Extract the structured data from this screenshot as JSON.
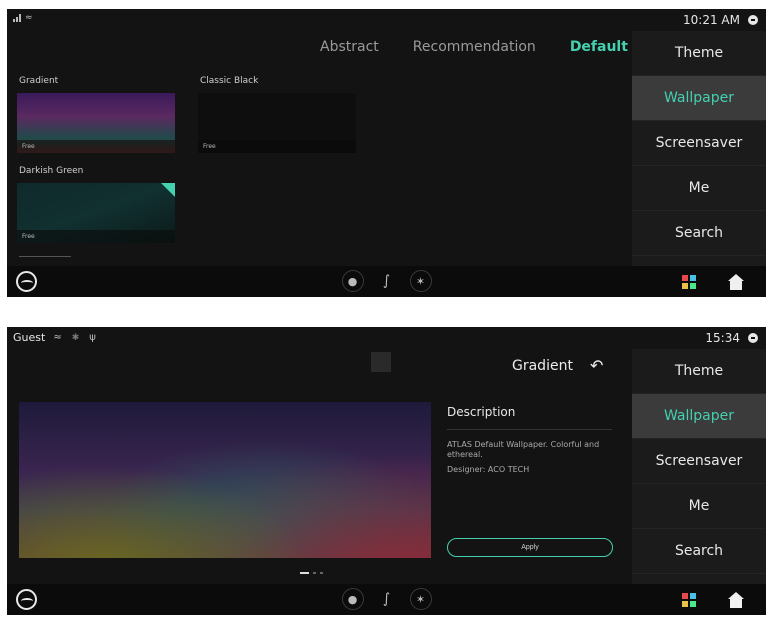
{
  "screen1": {
    "status": {
      "time": "10:21 AM"
    },
    "tabs": [
      {
        "label": "Abstract"
      },
      {
        "label": "Recommendation"
      },
      {
        "label": "Default"
      }
    ],
    "wallpapers": [
      {
        "name": "Gradient",
        "tag": "Free"
      },
      {
        "name": "Classic Black",
        "tag": "Free"
      },
      {
        "name": "Darkish Green",
        "tag": "Free"
      }
    ],
    "menu": [
      "Theme",
      "Wallpaper",
      "Screensaver",
      "Me",
      "Search"
    ]
  },
  "screen2": {
    "status": {
      "user": "Guest",
      "time": "15:34"
    },
    "title": "Gradient",
    "description": {
      "heading": "Description",
      "text": "ATLAS Default Wallpaper. Colorful and ethereal.",
      "designer": "Designer: ACO TECH"
    },
    "apply_label": "Apply",
    "menu": [
      "Theme",
      "Wallpaper",
      "Screensaver",
      "Me",
      "Search"
    ]
  },
  "colors": {
    "accent": "#45d0b0",
    "background": "#131313",
    "menu_active": "#3b3b3b"
  },
  "icons": [
    "signal-icon",
    "wifi-icon",
    "bluetooth-icon",
    "usb-icon",
    "message-icon",
    "brand-logo-icon",
    "temperature-icon",
    "seat-icon",
    "fan-icon",
    "apps-icon",
    "home-icon",
    "back-icon"
  ]
}
